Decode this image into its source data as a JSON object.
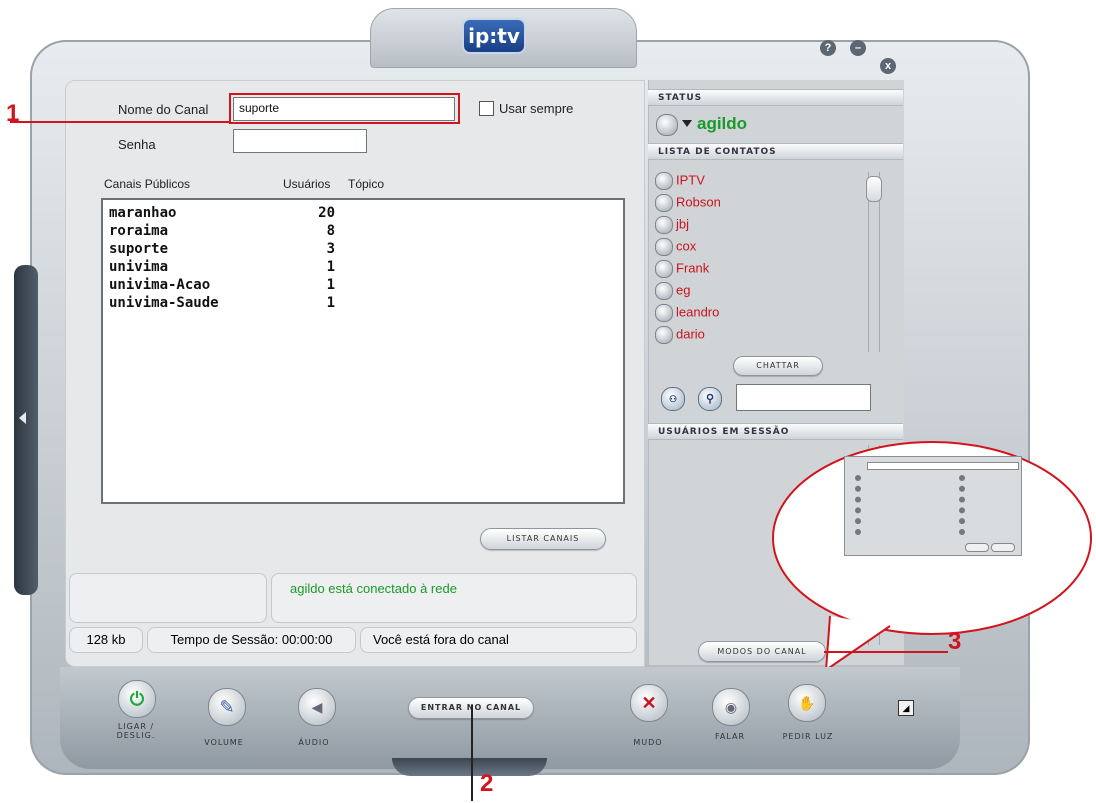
{
  "app": {
    "logo_text": "ip:tv"
  },
  "window_controls": {
    "help": "?",
    "minimize": "–",
    "close": "x"
  },
  "channel_form": {
    "name_label": "Nome do Canal",
    "name_value": "suporte",
    "always_use_label": "Usar sempre",
    "password_label": "Senha",
    "password_value": ""
  },
  "channel_list": {
    "headers": {
      "channels": "Canais Públicos",
      "users": "Usuários",
      "topic": "Tópico"
    },
    "rows": [
      {
        "name": "maranhao",
        "users": "20",
        "topic": ""
      },
      {
        "name": "roraima",
        "users": "8",
        "topic": ""
      },
      {
        "name": "suporte",
        "users": "3",
        "topic": ""
      },
      {
        "name": "univima",
        "users": "1",
        "topic": ""
      },
      {
        "name": "univima-Acao",
        "users": "1",
        "topic": ""
      },
      {
        "name": "univima-Saude",
        "users": "1",
        "topic": ""
      }
    ],
    "list_button": "LISTAR CANAIS"
  },
  "status_area": {
    "message": "agildo está conectado à rede",
    "bandwidth": "128 kb",
    "session_time": "Tempo de Sessão: 00:00:00",
    "channel_state": "Você está fora do canal"
  },
  "right_panel": {
    "status_header": "STATUS",
    "user_name": "agildo",
    "contacts_header": "LISTA DE CONTATOS",
    "contacts": [
      "IPTV",
      "Robson",
      "jbj",
      "cox",
      "Frank",
      "eg",
      "leandro",
      "dario"
    ],
    "chat_button": "CHATTAR",
    "search_value": "",
    "session_users_header": "USUÁRIOS EM SESSÃO",
    "channel_modes_button": "MODOS DO CANAL"
  },
  "bottom_bar": {
    "power_label": "LIGAR / DESLIG.",
    "volume_label": "VOLUME",
    "audio_label": "ÁUDIO",
    "enter_channel_button": "ENTRAR NO CANAL",
    "mute_label": "MUDO",
    "speak_label": "FALAR",
    "request_label": "PEDIR LUZ"
  },
  "annotations": {
    "one": "1",
    "two": "2",
    "three": "3"
  },
  "colors": {
    "contact_red": "#c8141c",
    "user_green": "#1a9a2a",
    "annotation_red": "#d2141c",
    "power_green": "#1ea83a"
  }
}
